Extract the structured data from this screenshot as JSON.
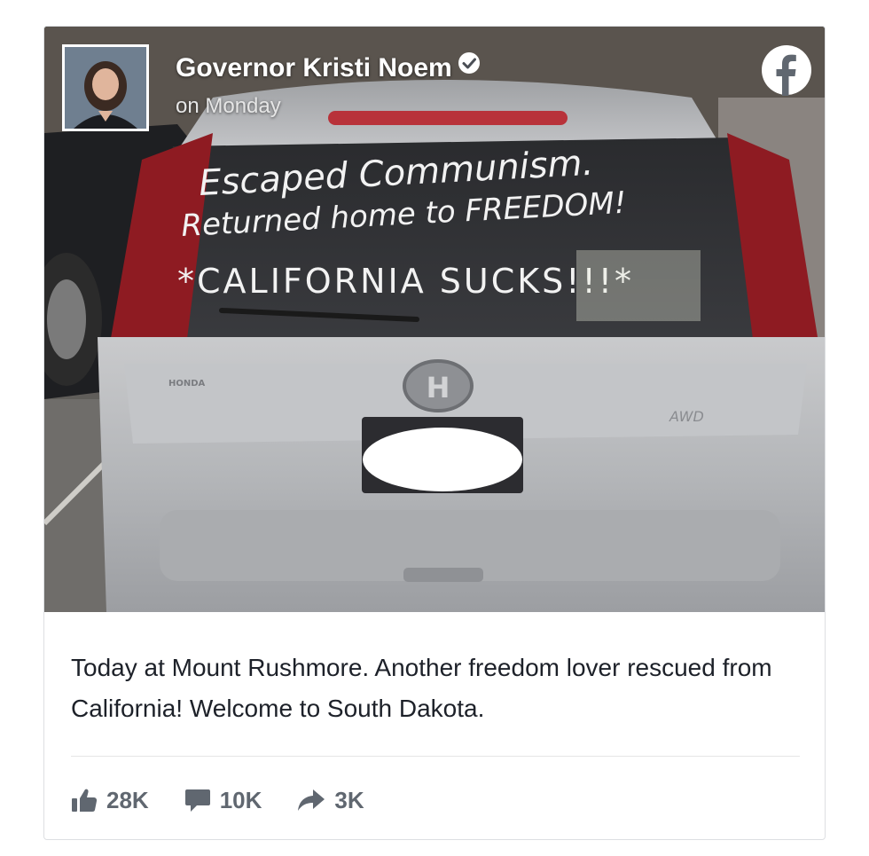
{
  "post": {
    "author": "Governor Kristi Noem",
    "timestamp": "on Monday",
    "caption": "Today at Mount Rushmore. Another freedom lover rescued from California! Welcome to South Dakota."
  },
  "image_text": {
    "line1": "Escaped Communism.",
    "line2": "Returned home to FREEDOM!",
    "line3": "*CALIFORNIA SUCKS!!!*"
  },
  "actions": {
    "likes": "28K",
    "comments": "10K",
    "shares": "3K"
  },
  "icons": {
    "brand": "facebook-logo-icon",
    "verified": "verified-badge-icon",
    "like": "thumbs-up-icon",
    "comment": "comment-bubble-icon",
    "share": "share-arrow-icon"
  },
  "colors": {
    "facebook": "#ffffff",
    "text": "#1d2129",
    "meta": "#606770",
    "border": "#dddfe2"
  }
}
